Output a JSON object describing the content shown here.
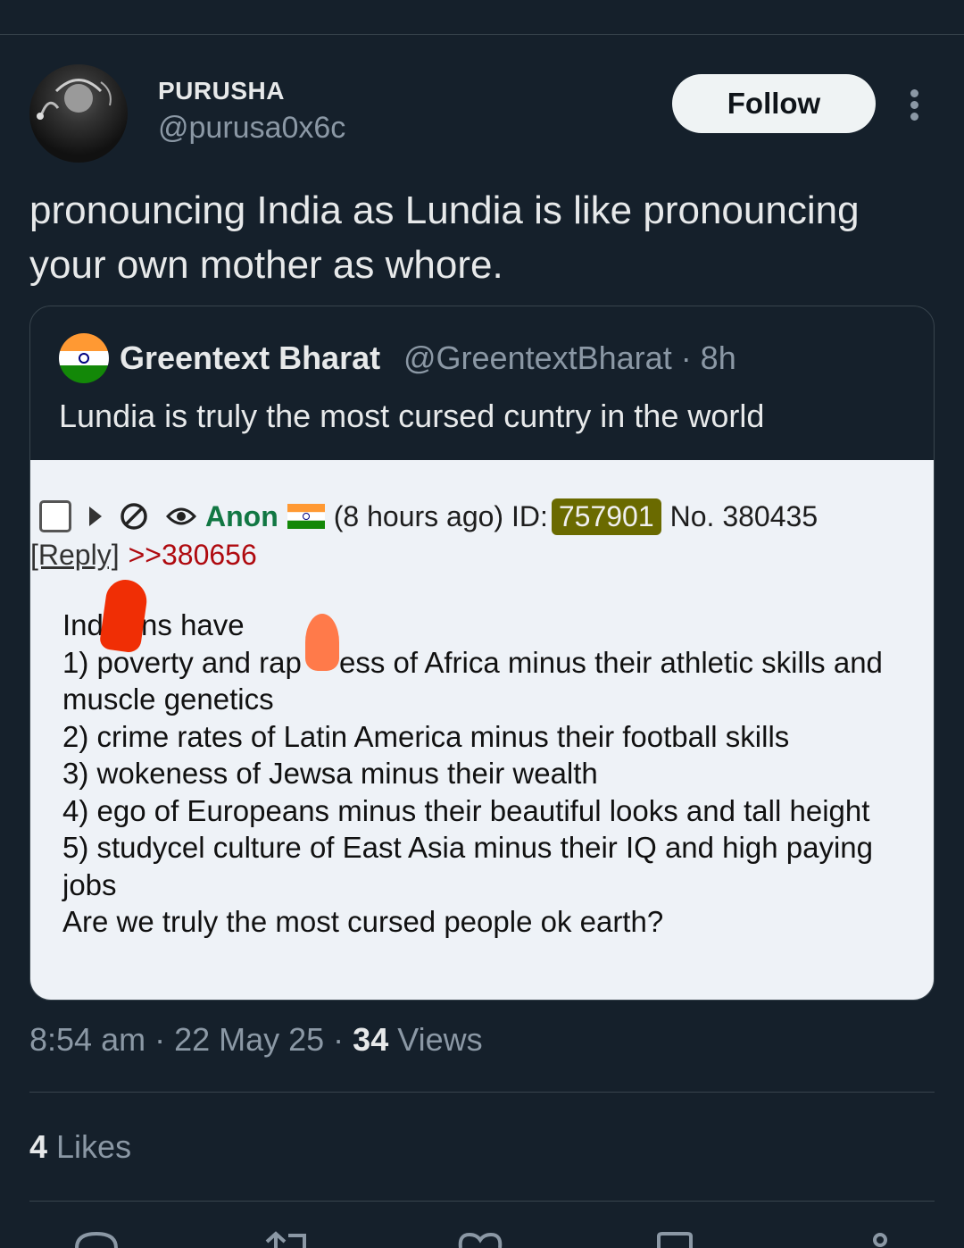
{
  "author": {
    "name": "PURUSHA",
    "handle": "@purusa0x6c"
  },
  "follow_label": "Follow",
  "tweet_text": "pronouncing India as Lundia is like pronouncing your own mother as whore.",
  "quote": {
    "name": "Greentext Bharat",
    "handle_time": "@GreentextBharat · 8h",
    "text": "Lundia is truly the most cursed cuntry in the world",
    "post": {
      "anon": "Anon",
      "time": "(8 hours ago) ID:",
      "id": "757901",
      "number": "No. 380435",
      "reply": "[Reply]",
      "ref": ">>380656",
      "lines": [
        "Ind  ns have",
        "1) poverty and rap  ess of Africa minus their athletic skills and muscle genetics",
        "2) crime rates of Latin America minus their football skills",
        "3) wokeness of Jewsa minus their wealth",
        "4) ego of Europeans minus their beautiful looks and tall height",
        "5) studycel culture of East Asia minus their IQ and high paying jobs",
        "Are we truly the most cursed people ok earth?"
      ]
    }
  },
  "meta": {
    "time": "8:54 am · 22 May 25 · ",
    "views_count": "34",
    "views_label": " Views"
  },
  "likes": {
    "count": "4",
    "label": " Likes"
  },
  "colors": {
    "background": "#15202b",
    "muted": "#8b98a5",
    "anon_green": "#117743",
    "id_box": "#6a6a00"
  }
}
